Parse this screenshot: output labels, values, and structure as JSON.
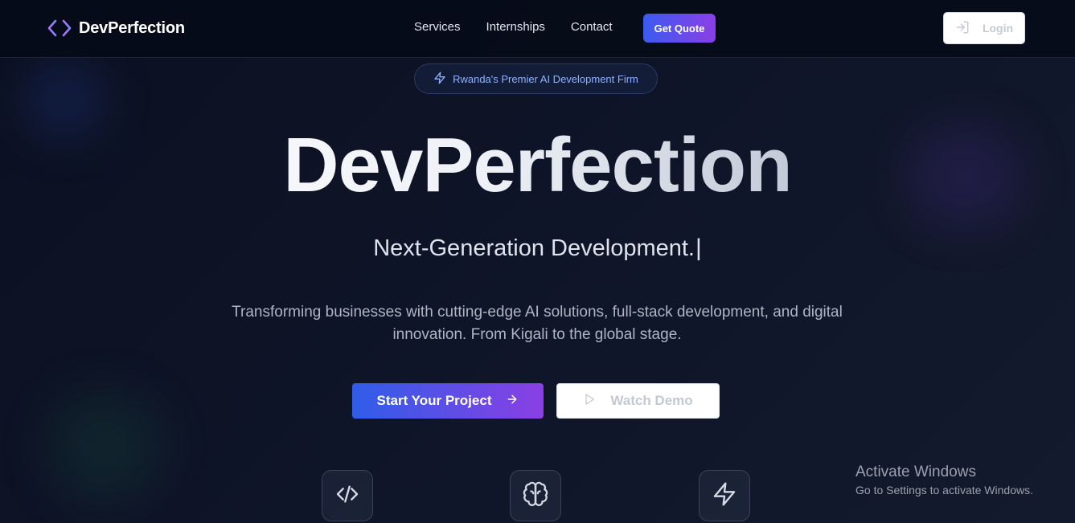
{
  "nav": {
    "brand": "DevPerfection",
    "links": [
      "Services",
      "Internships",
      "Contact"
    ],
    "quote_label": "Get Quote",
    "login_label": "Login"
  },
  "badge": {
    "text": "Rwanda's Premier AI Development Firm"
  },
  "hero": {
    "title": "DevPerfection",
    "subtitle": "Next-Generation Development.",
    "cursor": "|",
    "description": "Transforming businesses with cutting-edge AI solutions, full-stack development, and digital innovation. From Kigali to the global stage.",
    "primary_cta": "Start Your Project",
    "secondary_cta": "Watch Demo"
  },
  "features": [
    "code-icon",
    "brain-icon",
    "bolt-icon"
  ],
  "watermark": {
    "title": "Activate Windows",
    "subtitle": "Go to Settings to activate Windows."
  },
  "colors": {
    "background": "#0b1021",
    "accent_start": "#3b5bf0",
    "accent_end": "#8b3fe6",
    "badge_text": "#8fb2ff",
    "logo_icon": "#a78bfa"
  }
}
